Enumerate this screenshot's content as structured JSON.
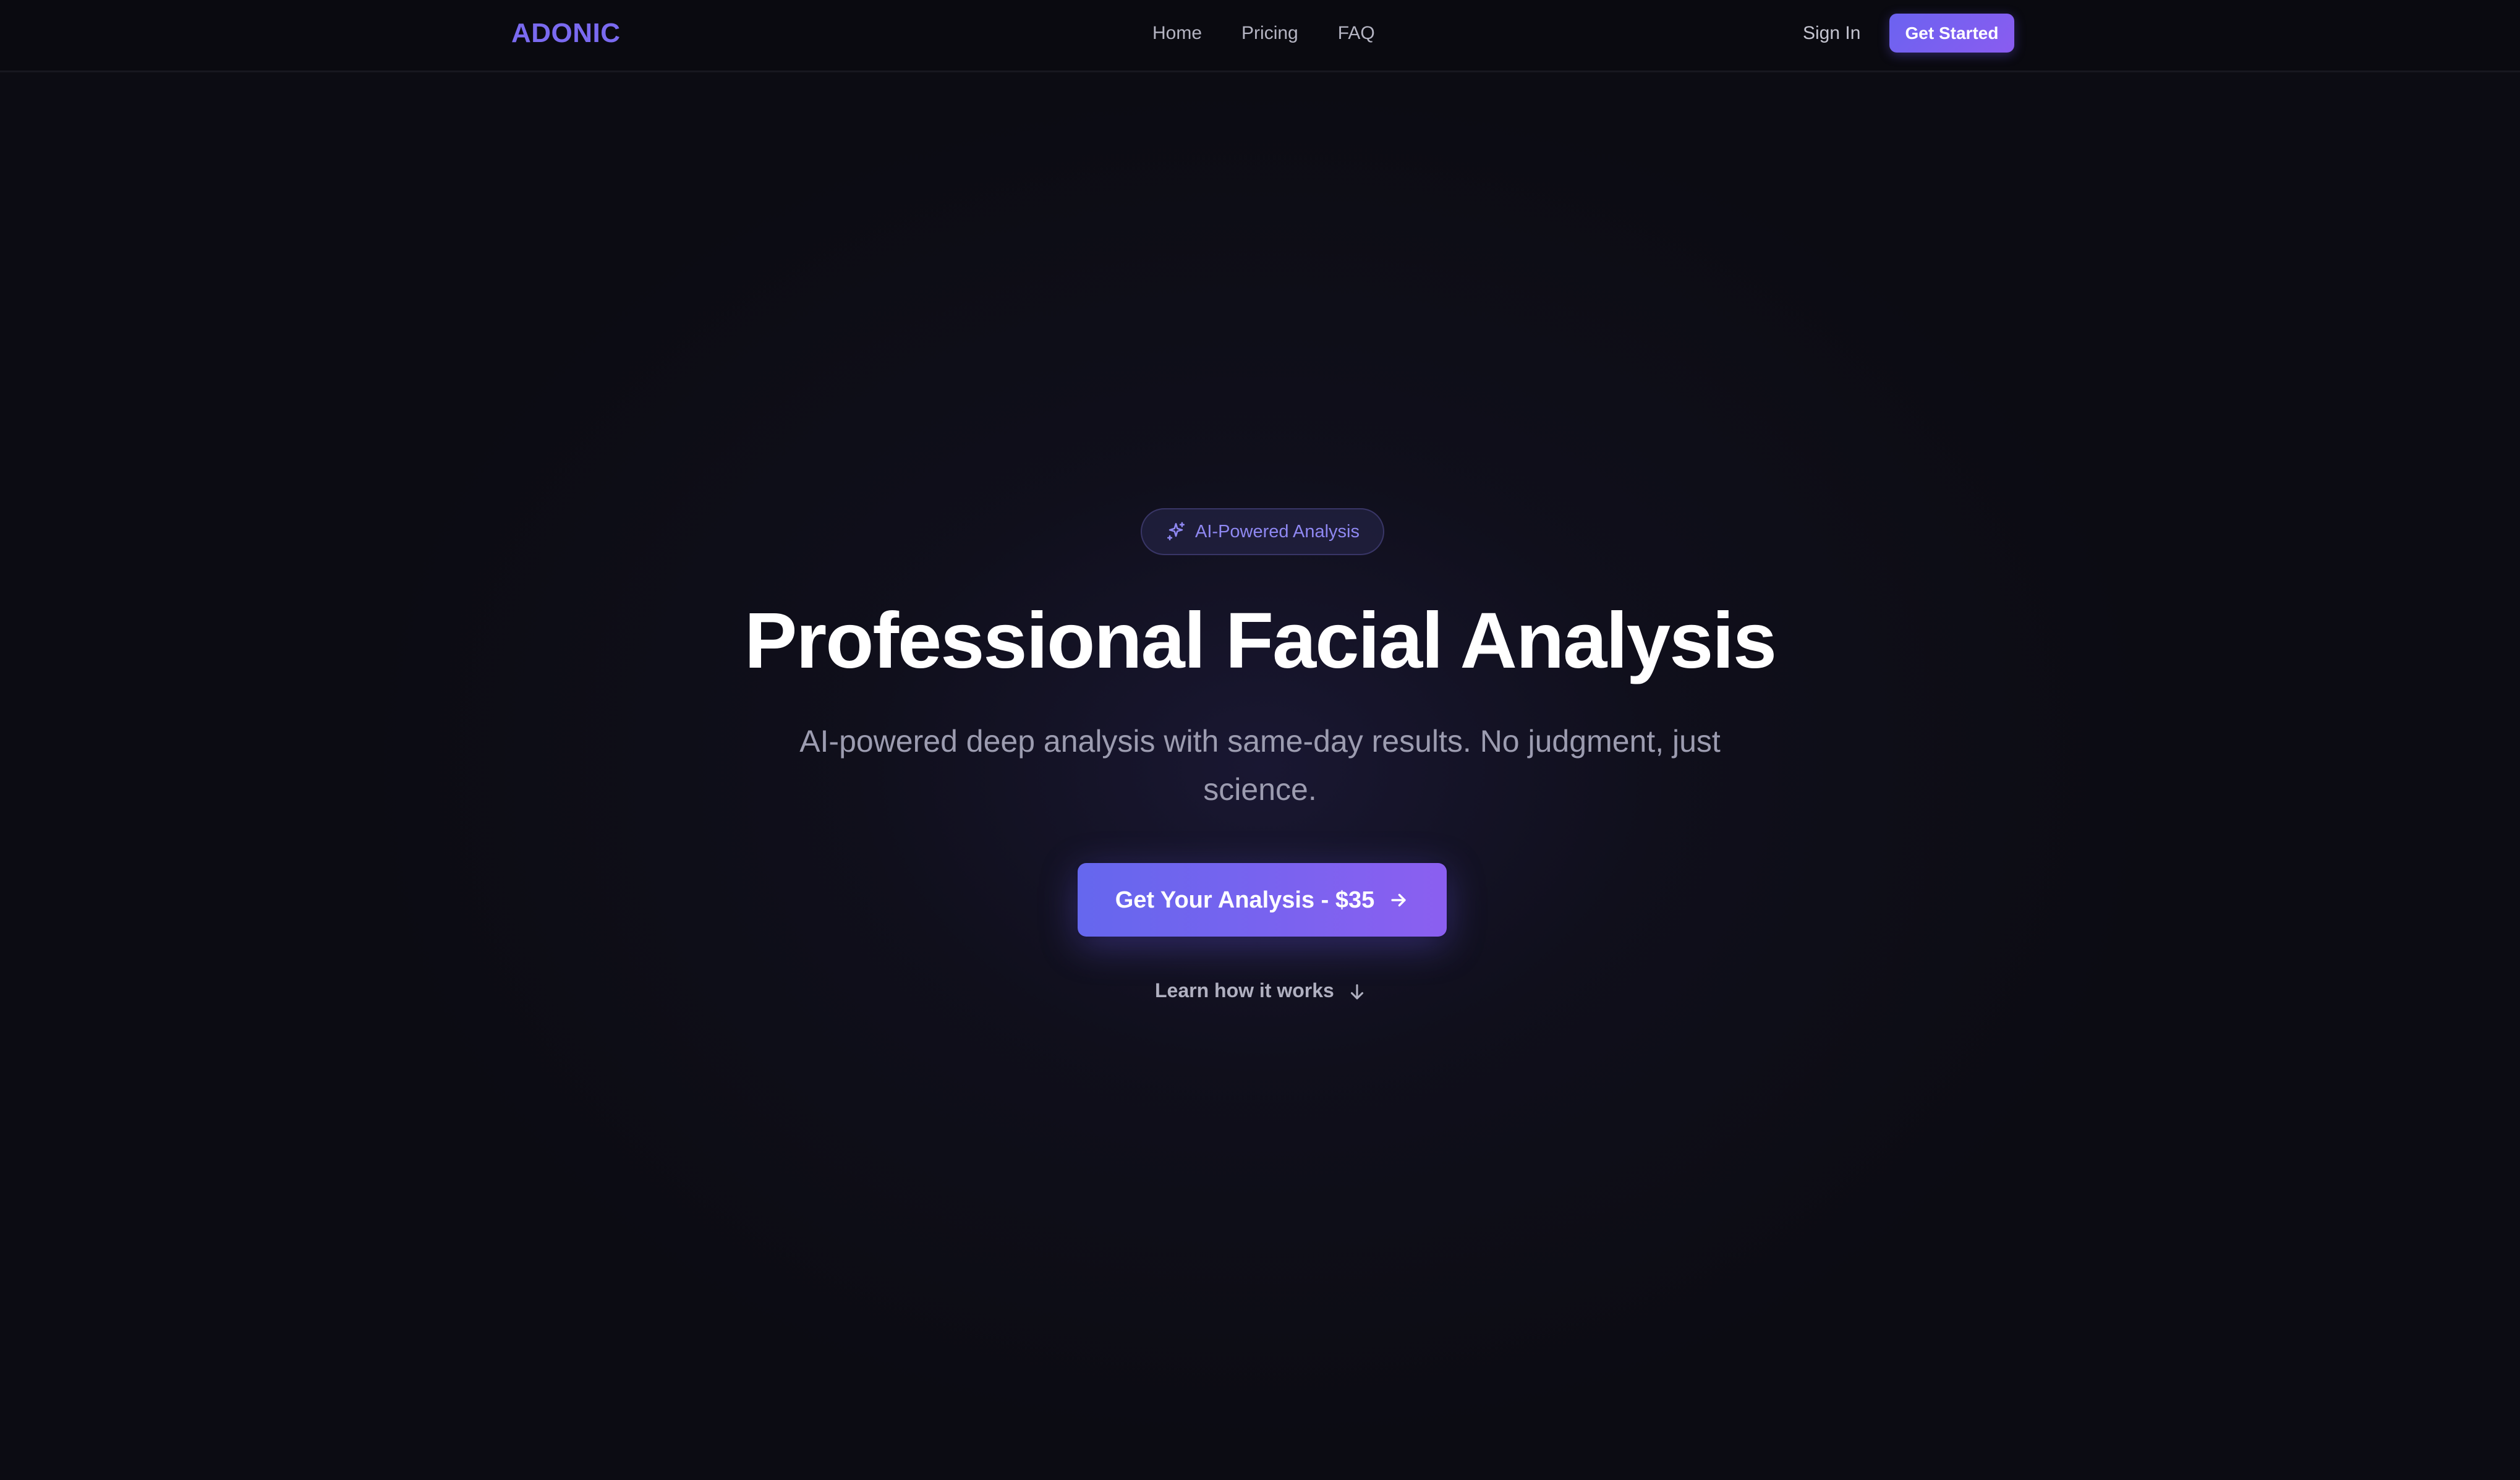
{
  "colors": {
    "background": "#0c0c13",
    "navbar": "#0a0a10",
    "accent": "#7a6af0",
    "button_gradient_start": "#6567ee",
    "button_gradient_end": "#8b5ff0",
    "title_text": "#ffffff",
    "muted_text": "#9c9cb0"
  },
  "header": {
    "logo": "ADONIC",
    "nav": {
      "home": "Home",
      "pricing": "Pricing",
      "faq": "FAQ"
    },
    "sign_in": "Sign In",
    "get_started": "Get Started"
  },
  "hero": {
    "badge": {
      "icon": "sparkles-icon",
      "label": "AI-Powered Analysis"
    },
    "title": "Professional Facial Analysis",
    "subtitle": "AI-powered deep analysis with same-day results. No judgment, just science.",
    "cta": {
      "label": "Get Your Analysis - $35",
      "icon": "arrow-right-icon"
    },
    "learn_more": {
      "label": "Learn how it works",
      "icon": "arrow-down-icon"
    }
  }
}
